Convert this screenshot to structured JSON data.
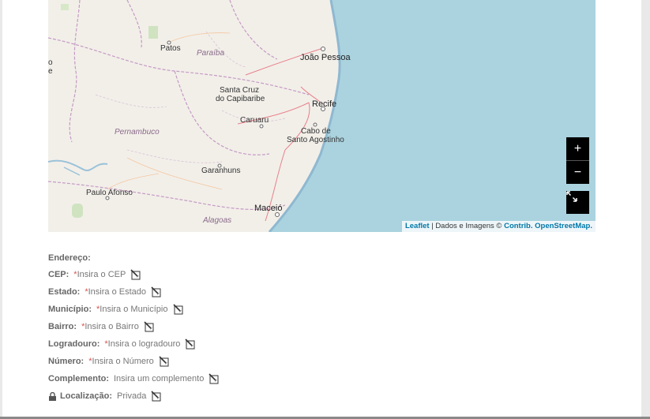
{
  "map": {
    "labels": {
      "patos": "Patos",
      "paraiba": "Paraíba",
      "joao_pessoa": "João Pessoa",
      "santa_cruz_1": "Santa Cruz",
      "santa_cruz_2": "do Capibaribe",
      "recife": "Recife",
      "caruaru": "Caruaru",
      "cabo_1": "Cabo de",
      "cabo_2": "Santo Agostinho",
      "pernambuco": "Pernambuco",
      "garanhuns": "Garanhuns",
      "paulo_afonso": "Paulo Afonso",
      "maceio": "Maceió",
      "alagoas": "Alagoas",
      "edge_o": "o",
      "edge_e": "e"
    },
    "controls": {
      "zoom_in": "+",
      "zoom_out": "−"
    },
    "attribution": {
      "leaflet": "Leaflet",
      "text": " | Dados e Imagens © ",
      "contrib": "Contrib.",
      "osm": "OpenStreetMap."
    },
    "colors": {
      "sea": "#aad3df",
      "land": "#f2efe9",
      "border": "#b07fb0",
      "road": "#e8808a"
    }
  },
  "address": {
    "title": "Endereço:",
    "fields": [
      {
        "label": "CEP:",
        "required": "*",
        "value": "Insira o CEP"
      },
      {
        "label": "Estado:",
        "required": "*",
        "value": "Insira o Estado"
      },
      {
        "label": "Município:",
        "required": "*",
        "value": "Insira o Município"
      },
      {
        "label": "Bairro:",
        "required": "*",
        "value": "Insira o Bairro"
      },
      {
        "label": "Logradouro:",
        "required": "*",
        "value": "Insira o logradouro"
      },
      {
        "label": "Número:",
        "required": "*",
        "value": "Insira o Número"
      },
      {
        "label": "Complemento:",
        "required": "",
        "value": "Insira um complemento"
      },
      {
        "label": "Localização:",
        "required": "",
        "value": "Privada"
      }
    ]
  }
}
